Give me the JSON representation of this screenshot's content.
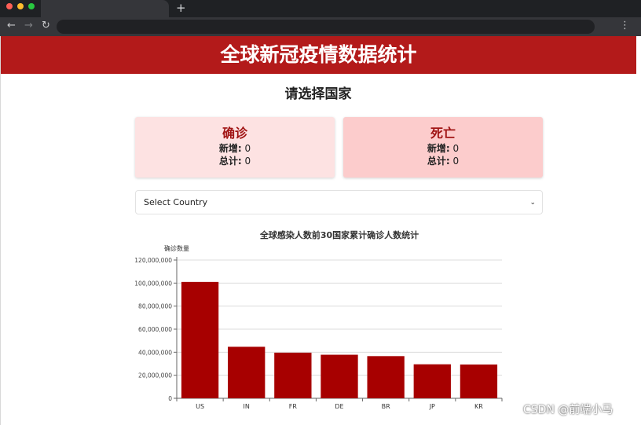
{
  "browser": {
    "new_tab_glyph": "+",
    "back_glyph": "←",
    "forward_glyph": "→",
    "reload_glyph": "↻",
    "menu_glyph": "⋮"
  },
  "page": {
    "header_title": "全球新冠疫情数据统计",
    "prompt": "请选择国家",
    "colors": {
      "header": "#b31a1a",
      "confirmed_card": "#fde2e2",
      "deaths_card": "#fccccc",
      "bar": "#a70000"
    }
  },
  "cards": {
    "confirmed": {
      "title": "确诊",
      "new_label": "新增:",
      "new_value": "0",
      "total_label": "总计:",
      "total_value": "0"
    },
    "deaths": {
      "title": "死亡",
      "new_label": "新增:",
      "new_value": "0",
      "total_label": "总计:",
      "total_value": "0"
    }
  },
  "country_select": {
    "value": "Select Country"
  },
  "chart_data": {
    "type": "bar",
    "title": "全球感染人数前30国家累计确诊人数统计",
    "ylabel": "确诊数量",
    "xlabel": "",
    "categories": [
      "US",
      "IN",
      "FR",
      "DE",
      "BR",
      "JP",
      "KR"
    ],
    "values": [
      101000000,
      44700000,
      39600000,
      37800000,
      36600000,
      29500000,
      29300000
    ],
    "ylim": [
      0,
      120000000
    ],
    "yticks": [
      0,
      20000000,
      40000000,
      60000000,
      80000000,
      100000000,
      120000000
    ],
    "ytick_labels": [
      "0",
      "20,000,000",
      "40,000,000",
      "60,000,000",
      "80,000,000",
      "100,000,000",
      "120,000,000"
    ],
    "grid": true,
    "bar_color": "#a70000"
  },
  "watermark": "CSDN @前端小马"
}
